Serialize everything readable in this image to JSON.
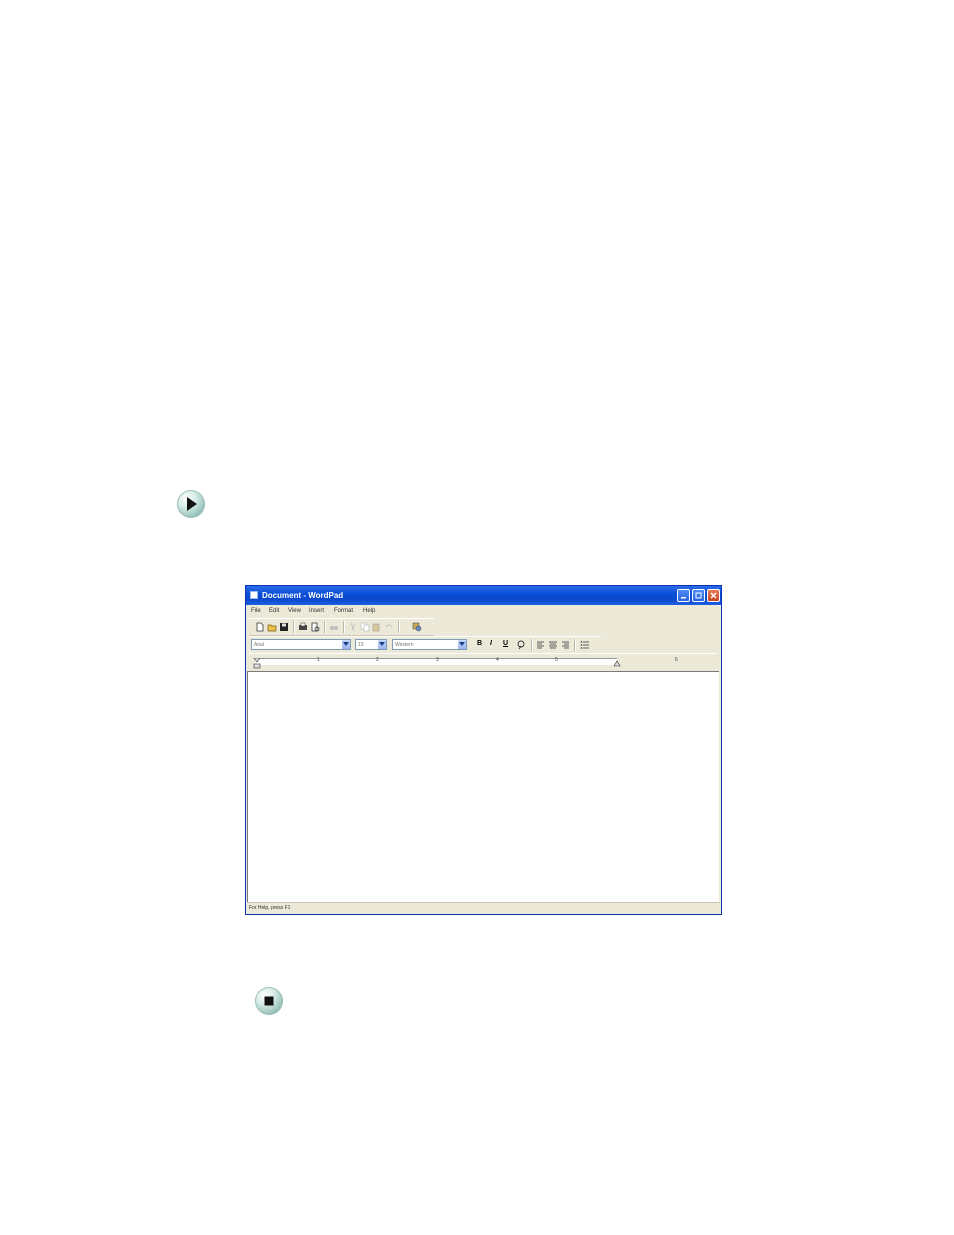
{
  "window": {
    "title": "Document - WordPad",
    "menu": [
      "File",
      "Edit",
      "View",
      "Insert",
      "Format",
      "Help"
    ],
    "font_name": "Arial",
    "font_size": "10",
    "script": "Western",
    "format_buttons": [
      "B",
      "I",
      "U"
    ],
    "ruler_numbers": [
      "1",
      "2",
      "3",
      "4",
      "5",
      "6"
    ],
    "status": "For Help, press F1"
  },
  "icons": {
    "step_icon": "arrow-right-icon",
    "end_icon": "stop-square-icon"
  },
  "colors": {
    "titlebar": "#0a48cc",
    "icon_teal": "#8fbcb3"
  }
}
